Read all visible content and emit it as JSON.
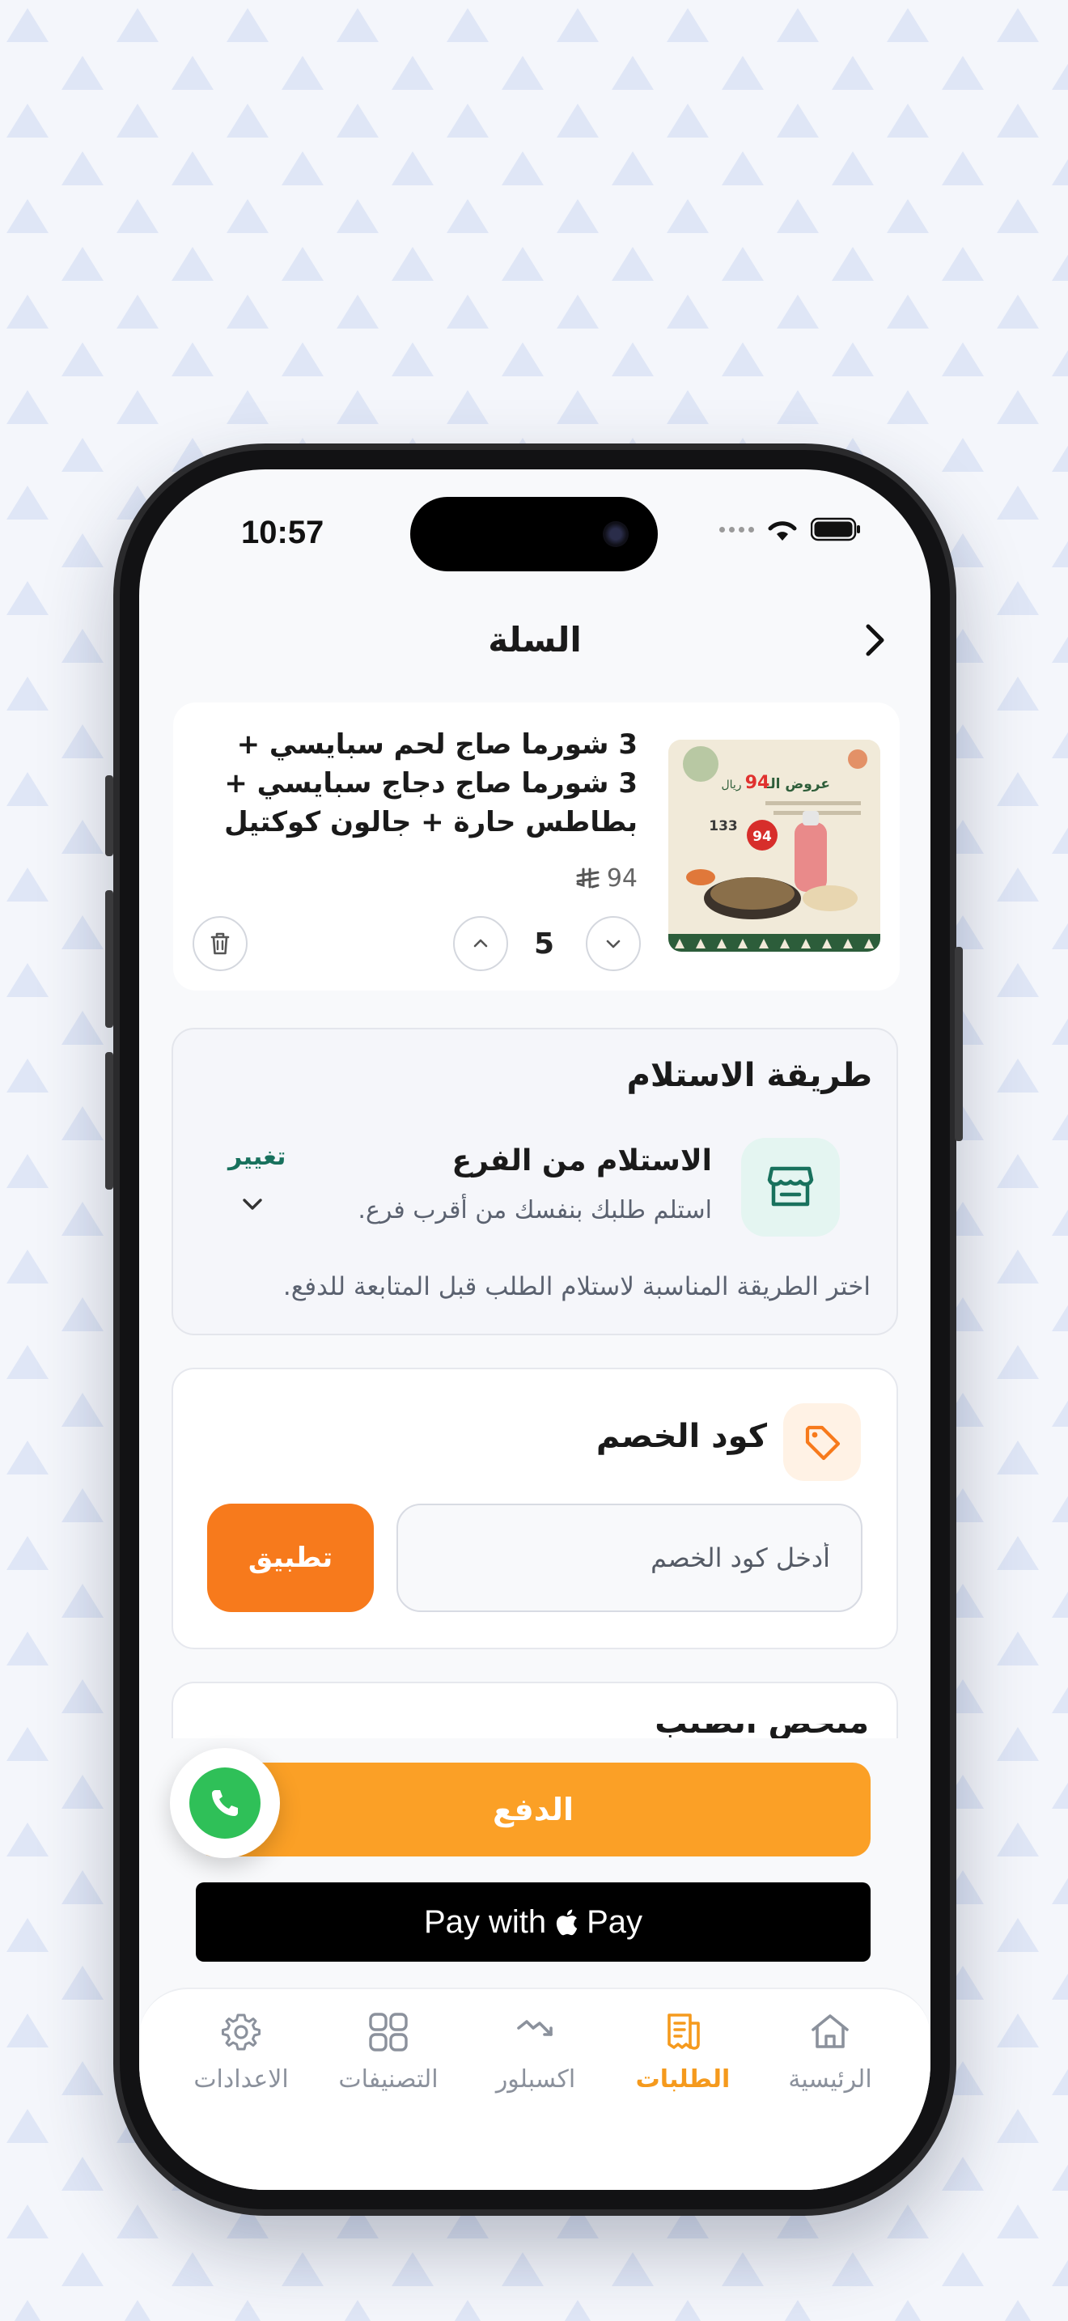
{
  "status_bar": {
    "time": "10:57"
  },
  "header": {
    "title": "السلة"
  },
  "cart_item": {
    "title": "3 شورما صاج لحم سبايسي + 3 شورما صاج دجاج سبايسي + بطاطس حارة + جالون كوكتيل",
    "price": "94",
    "currency_symbol": "⃁",
    "quantity": "5",
    "image_texts": {
      "offer": "عروض الـ",
      "offer_price": "94",
      "riyal": "ريال",
      "old_price": "133",
      "badge": "94"
    }
  },
  "pickup": {
    "section_title": "طريقة الاستلام",
    "method_title": "الاستلام من الفرع",
    "method_subtitle": "استلم طلبك بنفسك من أقرب فرع.",
    "change_label": "تغيير",
    "hint": "اختر الطريقة المناسبة لاستلام الطلب قبل المتابعة للدفع."
  },
  "discount": {
    "section_title": "كود الخصم",
    "input_placeholder": "أدخل كود الخصم",
    "apply_label": "تطبيق"
  },
  "next_section": {
    "partial_title": "ملخص الطلب"
  },
  "payment": {
    "pay_label": "الدفع",
    "apple_pay_prefix": "Pay with",
    "apple_pay_suffix": "Pay"
  },
  "colors": {
    "accent_orange": "#fba026",
    "apply_orange": "#f77a1c",
    "teal": "#18715d",
    "whatsapp_green": "#2fc058"
  },
  "tabbar": {
    "items": [
      {
        "label": "الرئيسية",
        "icon": "home-icon",
        "active": false
      },
      {
        "label": "الطلبات",
        "icon": "orders-icon",
        "active": true
      },
      {
        "label": "اكسبلور",
        "icon": "explore-icon",
        "active": false
      },
      {
        "label": "التصنيفات",
        "icon": "categories-icon",
        "active": false
      },
      {
        "label": "الاعدادات",
        "icon": "settings-icon",
        "active": false
      }
    ]
  }
}
